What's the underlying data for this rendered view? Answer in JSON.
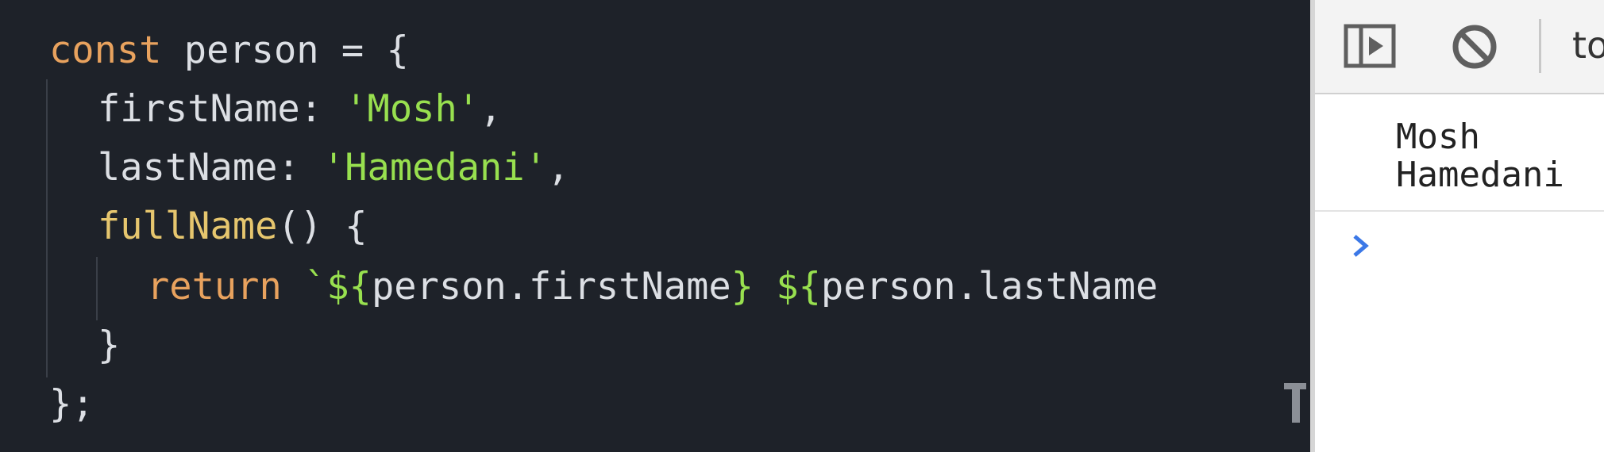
{
  "editor": {
    "lines": {
      "l1": {
        "kw": "const",
        "rest": " person = {"
      },
      "l2": {
        "key": "firstName: ",
        "str": "'Mosh'",
        "end": ","
      },
      "l3": {
        "key": "lastName: ",
        "str": "'Hamedani'",
        "end": ","
      },
      "l4": {
        "fn": "fullName",
        "rest": "() {"
      },
      "l5": {
        "kw": "return",
        "tick": " `",
        "open1": "${",
        "expr1": "person.firstName",
        "close1": "}",
        "space": " ",
        "open2": "${",
        "expr2": "person.lastName"
      },
      "l6": {
        "text": "}"
      },
      "l7": {
        "text": "};"
      }
    }
  },
  "devtools": {
    "toolbar": {
      "sidebar_icon": "show-sidebar-icon",
      "clear_icon": "clear-console-icon",
      "context": "to"
    },
    "console": {
      "messages": [
        "Mosh",
        "Hamedani"
      ],
      "prompt_icon": "chevron-right-icon"
    }
  }
}
